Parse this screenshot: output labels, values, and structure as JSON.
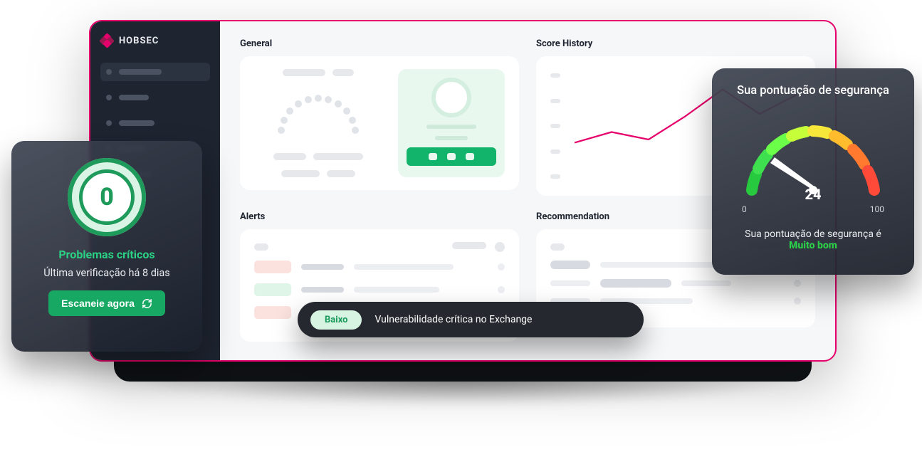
{
  "brand": {
    "name": "HOBSEC"
  },
  "sidebar": {
    "items": [
      {
        "active": true
      },
      {
        "active": false
      },
      {
        "active": false
      },
      {
        "active": false
      },
      {
        "active": false
      }
    ]
  },
  "sections": {
    "general": "General",
    "score_history": "Score History",
    "alerts": "Alerts",
    "recommendation": "Recommendation"
  },
  "critical_card": {
    "count": "0",
    "title": "Problemas críticos",
    "subtitle": "Última verificação há 8 dias",
    "button": "Escaneie agora"
  },
  "toast": {
    "badge": "Baixo",
    "text": "Vulnerabilidade crítica no Exchange"
  },
  "score_card": {
    "title": "Sua pontuação de segurança",
    "value": "24",
    "min": "0",
    "max": "100",
    "subtitle_prefix": "Sua pontuação de segurança é",
    "status": "Muito bom"
  },
  "chart_data": {
    "type": "line",
    "title": "Score History",
    "xlabel": "",
    "ylabel": "",
    "ylim": [
      0,
      100
    ],
    "x": [
      0,
      1,
      2,
      3,
      4,
      5,
      6
    ],
    "values": [
      35,
      45,
      38,
      60,
      85,
      62,
      80
    ],
    "series_color": "#e6006b"
  }
}
